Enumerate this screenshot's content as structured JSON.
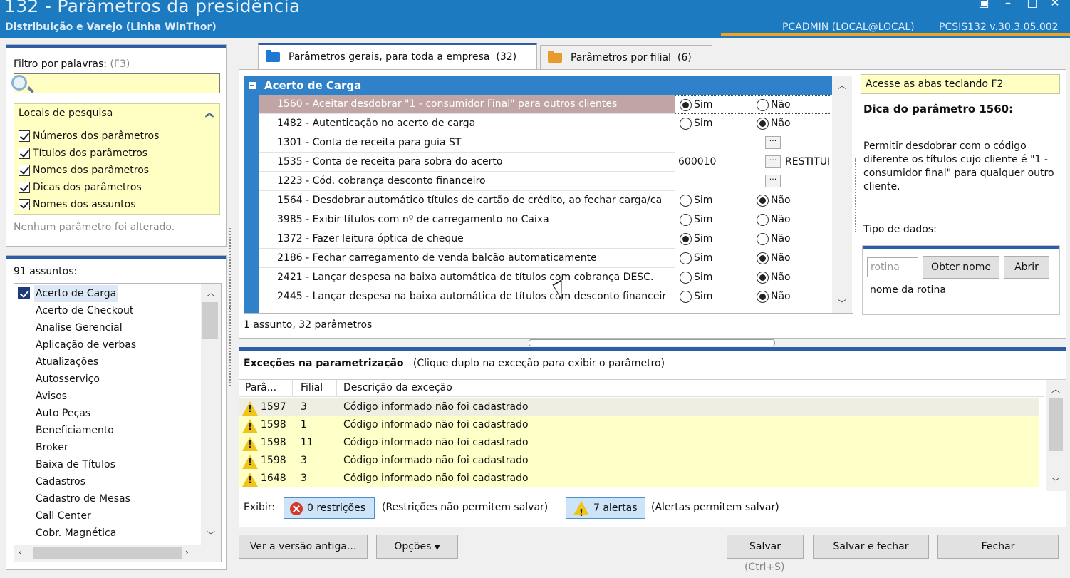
{
  "window": {
    "title": "132 - Parâmetros da presidência",
    "subtitle": "Distribuição e Varejo (Linha WinThor)",
    "user": "PCADMIN (LOCAL@LOCAL)",
    "version": "PCSIS132  v.30.3.05.002",
    "accent": "#1c7ac0"
  },
  "filter": {
    "label": "Filtro por palavras:",
    "hint": "(F3)",
    "value": "",
    "locais_title": "Locais de pesquisa",
    "options": [
      "Números dos parâmetros",
      "Títulos dos parâmetros",
      "Nomes dos parâmetros",
      "Dicas dos parâmetros",
      "Nomes dos assuntos"
    ],
    "status": "Nenhum parâmetro foi alterado."
  },
  "subjects": {
    "count_label": "91 assuntos:",
    "items": [
      "Acerto de Carga",
      "Acerto de Checkout",
      "Analise Gerencial",
      "Aplicação de verbas",
      "Atualizações",
      "Autosserviço",
      "Avisos",
      "Auto Peças",
      "Beneficiamento",
      "Broker",
      "Baixa de Títulos",
      "Cadastros",
      "Cadastro de Mesas",
      "Call Center",
      "Cobr. Magnética"
    ]
  },
  "tabs": [
    {
      "label": "Parâmetros gerais, para toda a empresa",
      "count": "(32)"
    },
    {
      "label": "Parâmetros por filial",
      "count": "(6)"
    }
  ],
  "group": {
    "title": "Acerto de Carga"
  },
  "labels": {
    "sim": "Sim",
    "nao": "Não",
    "dots": "···"
  },
  "params": [
    {
      "title": "1560 - Aceitar desdobrar \"1 - consumidor Final\" para outros clientes",
      "kind": "radio",
      "sim": true
    },
    {
      "title": "1482 - Autenticação no acerto de carga",
      "kind": "radio",
      "sim": false
    },
    {
      "title": "1301 - Conta de receita para guia ST",
      "kind": "lookup",
      "code": "",
      "desc": ""
    },
    {
      "title": "1535 - Conta de receita para sobra do acerto",
      "kind": "lookup",
      "code": "600010",
      "desc": "RESTITUI"
    },
    {
      "title": "1223 - Cód. cobrança desconto financeiro",
      "kind": "lookup",
      "code": "",
      "desc": ""
    },
    {
      "title": "1564 - Desdobrar automático títulos de cartão de crédito, ao fechar carga/ca",
      "kind": "radio",
      "sim": false
    },
    {
      "title": "3985 - Exibir títulos com nº de carregamento no Caixa",
      "kind": "radio",
      "sim": null
    },
    {
      "title": "1372 - Fazer leitura óptica de cheque",
      "kind": "radio",
      "sim": true
    },
    {
      "title": "2186 - Fechar carregamento de venda balcão automaticamente",
      "kind": "radio",
      "sim": false
    },
    {
      "title": "2421 - Lançar despesa na baixa automática de títulos com cobrança DESC.",
      "kind": "radio",
      "sim": false
    },
    {
      "title": "2445 - Lançar despesa na baixa automática de títulos com desconto financeir",
      "kind": "radio",
      "sim": false
    }
  ],
  "grid_status": "1 assunto, 32 parâmetros",
  "tip": {
    "header": "Acesse as abas teclando F2",
    "title": "Dica do parâmetro 1560:",
    "text": "Permitir desdobrar com o código diferente os títulos cujo cliente é \"1 - consumidor final\" para qualquer outro cliente.",
    "type_label": "Tipo de dados:",
    "rotina_placeholder": "rotina",
    "obter_nome": "Obter nome",
    "abrir": "Abrir",
    "rotina_name": "nome da rotina"
  },
  "exceptions": {
    "title": "Exceções na parametrização",
    "subtitle": "(Clique duplo na exceção para exibir o parâmetro)",
    "columns": [
      "Parâ...",
      "Filial",
      "Descrição da exceção"
    ],
    "rows": [
      {
        "param": "1597",
        "filial": "3",
        "desc": "Código informado não foi cadastrado"
      },
      {
        "param": "1598",
        "filial": "1",
        "desc": "Código informado não foi cadastrado"
      },
      {
        "param": "1598",
        "filial": "11",
        "desc": "Código informado não foi cadastrado"
      },
      {
        "param": "1598",
        "filial": "3",
        "desc": "Código informado não foi cadastrado"
      },
      {
        "param": "1648",
        "filial": "3",
        "desc": "Código informado não foi cadastrado"
      }
    ],
    "exibir": "Exibir:",
    "restricoes": "0 restrições",
    "restricoes_note": "(Restrições não permitem salvar)",
    "alertas": "7 alertas",
    "alertas_note": "(Alertas permitem salvar)"
  },
  "buttons": {
    "versao_antiga": "Ver a versão antiga...",
    "opcoes": "Opções",
    "salvar": "Salvar",
    "salvar_hint": "(Ctrl+S)",
    "salvar_fechar": "Salvar e fechar",
    "fechar": "Fechar"
  }
}
